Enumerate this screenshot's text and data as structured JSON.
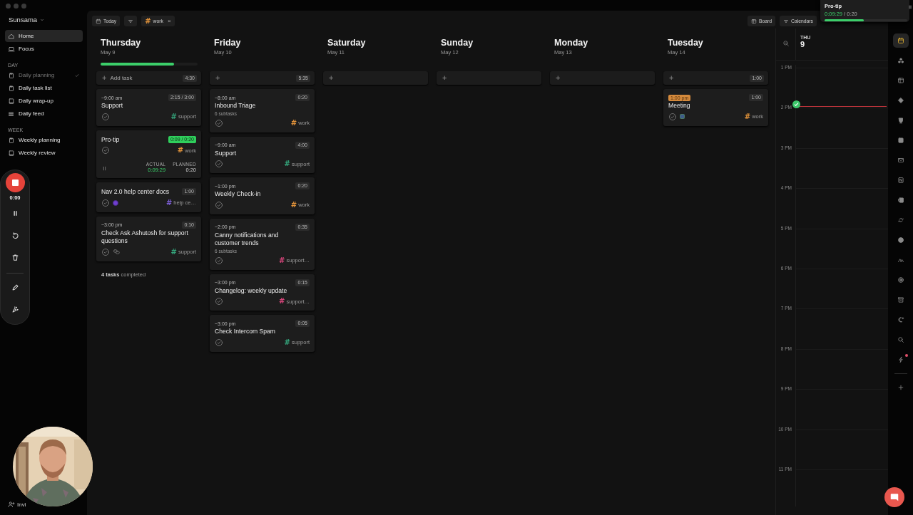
{
  "sidebar": {
    "title": "Sunsama",
    "nav": [
      {
        "label": "Home",
        "kind": "home",
        "selected": true
      },
      {
        "label": "Focus",
        "kind": "focus",
        "selected": false
      }
    ],
    "sections": [
      {
        "heading": "DAY",
        "items": [
          {
            "label": "Daily planning",
            "kind": "clipboard",
            "done": true,
            "selected": false
          },
          {
            "label": "Daily task list",
            "kind": "clipboard",
            "done": false,
            "selected": false
          },
          {
            "label": "Daily wrap-up",
            "kind": "book",
            "done": false,
            "selected": false
          },
          {
            "label": "Daily feed",
            "kind": "feed",
            "done": false,
            "selected": false
          }
        ]
      },
      {
        "heading": "WEEK",
        "items": [
          {
            "label": "Weekly planning",
            "kind": "clipboard",
            "done": false,
            "selected": false
          },
          {
            "label": "Weekly review",
            "kind": "book",
            "done": false,
            "selected": false
          }
        ]
      }
    ],
    "invite": "Invi"
  },
  "toolbar": {
    "today": "Today",
    "filter_chip": {
      "mark": "#",
      "label": "work",
      "color": "#e0923a",
      "close": "×"
    },
    "board": "Board",
    "calendars": "Calendars"
  },
  "days": [
    {
      "name": "Thursday",
      "date": "May 9",
      "progress": {
        "level": 0.76
      },
      "add": {
        "icon": "+",
        "label": "Add task",
        "duration": "4:30"
      },
      "tasks": [
        {
          "time": "~9:00 am",
          "time_badge": false,
          "title": "Support",
          "duration": "2:15 / 3:00",
          "running": false,
          "tag": {
            "mark": "#",
            "label": "support",
            "color": "#34a37a"
          }
        },
        {
          "title": "Pro-tip",
          "duration": "0:09 / 0:20",
          "running": true,
          "tag": {
            "mark": "#",
            "label": "work",
            "color": "#e0923a"
          },
          "timer": {
            "actual_label": "ACTUAL",
            "actual": "0:09:29",
            "planned_label": "PLANNED",
            "planned": "0:20"
          }
        },
        {
          "title": "Nav 2.0 help center docs",
          "duration": "1:00",
          "running": false,
          "attachment": {
            "kind": "dot"
          },
          "tag": {
            "mark": "#",
            "label": "help ce…",
            "color": "#7d5fd6"
          }
        },
        {
          "time": "~3:00 pm",
          "time_badge": false,
          "title": "Check Ask Ashutosh for support questions",
          "duration": "0:10",
          "running": false,
          "attachment": {
            "kind": "chat"
          },
          "tag": {
            "mark": "#",
            "label": "support",
            "color": "#34a37a"
          }
        }
      ],
      "footer": "**4 tasks** completed"
    },
    {
      "name": "Friday",
      "date": "May 10",
      "add": {
        "icon": "+",
        "duration": "5:35"
      },
      "tasks": [
        {
          "time": "~8:00 am",
          "time_badge": false,
          "title": "Inbound Triage",
          "subtasks": "6 subtasks",
          "duration": "0:20",
          "running": false,
          "tag": {
            "mark": "#",
            "label": "work",
            "color": "#e0923a"
          }
        },
        {
          "time": "~9:00 am",
          "time_badge": false,
          "title": "Support",
          "duration": "4:00",
          "running": false,
          "tag": {
            "mark": "#",
            "label": "support",
            "color": "#34a37a"
          }
        },
        {
          "time": "~1:00 pm",
          "time_badge": false,
          "title": "Weekly Check-in",
          "duration": "0:20",
          "running": false,
          "tag": {
            "mark": "#",
            "label": "work",
            "color": "#e0923a"
          }
        },
        {
          "time": "~2:00 pm",
          "time_badge": false,
          "title": "Canny notifications and customer trends",
          "subtasks": "6 subtasks",
          "duration": "0:35",
          "running": false,
          "tag": {
            "mark": "#",
            "label": "support…",
            "color": "#d6457a"
          }
        },
        {
          "time": "~3:00 pm",
          "time_badge": false,
          "title": "Changelog: weekly update",
          "duration": "0:15",
          "running": false,
          "tag": {
            "mark": "#",
            "label": "support…",
            "color": "#d6457a"
          }
        },
        {
          "time": "~3:00 pm",
          "time_badge": false,
          "title": "Check Intercom Spam",
          "duration": "0:05",
          "running": false,
          "tag": {
            "mark": "#",
            "label": "support",
            "color": "#34a37a"
          }
        }
      ]
    },
    {
      "name": "Saturday",
      "date": "May 11",
      "add": {
        "icon": "+"
      }
    },
    {
      "name": "Sunday",
      "date": "May 12",
      "add": {
        "icon": "+"
      }
    },
    {
      "name": "Monday",
      "date": "May 13",
      "add": {
        "icon": "+"
      }
    },
    {
      "name": "Tuesday",
      "date": "May 14",
      "add": {
        "icon": "+",
        "duration": "1:00"
      },
      "tasks": [
        {
          "time": "1:00 pm",
          "time_badge": true,
          "title": "Meeting",
          "duration": "1:00",
          "running": false,
          "attachment": {
            "kind": "calendar"
          },
          "tag": {
            "mark": "#",
            "label": "work",
            "color": "#e0923a"
          }
        }
      ]
    }
  ],
  "calendar": {
    "weekday": "THU",
    "day": "9",
    "hours": [
      "1 PM",
      "2 PM",
      "3 PM",
      "4 PM",
      "5 PM",
      "6 PM",
      "7 PM",
      "8 PM",
      "9 PM",
      "10 PM",
      "11 PM"
    ]
  },
  "rail": {
    "items": [
      {
        "kind": "calendar",
        "selected": true,
        "alert": false
      },
      {
        "kind": "dots",
        "selected": false,
        "alert": false
      },
      {
        "kind": "board",
        "selected": false,
        "alert": false
      },
      {
        "kind": "diamond",
        "selected": false,
        "alert": false
      },
      {
        "kind": "cup",
        "selected": false,
        "alert": false
      },
      {
        "kind": "square",
        "selected": false,
        "alert": false
      },
      {
        "kind": "envelope",
        "selected": false,
        "alert": false
      },
      {
        "kind": "notebook",
        "selected": false,
        "alert": false
      },
      {
        "kind": "document",
        "selected": false,
        "alert": false
      },
      {
        "kind": "sync",
        "selected": false,
        "alert": false
      },
      {
        "kind": "ball",
        "selected": false,
        "alert": false
      },
      {
        "kind": "chevrons",
        "selected": false,
        "alert": false
      },
      {
        "kind": "target",
        "selected": false,
        "alert": false
      },
      {
        "kind": "archive",
        "selected": false,
        "alert": false
      },
      {
        "kind": "moon",
        "selected": false,
        "alert": false
      },
      {
        "kind": "search",
        "selected": false,
        "alert": false
      },
      {
        "kind": "bolt",
        "selected": false,
        "alert": true
      },
      {
        "kind": "plus",
        "selected": false,
        "alert": false
      }
    ]
  },
  "recorder": {
    "elapsed": "0:00"
  },
  "timer_popup": {
    "title": "Pro-tip",
    "elapsed": "0:09:29",
    "separator": "/",
    "planned": "0:20",
    "level": 0.47
  }
}
